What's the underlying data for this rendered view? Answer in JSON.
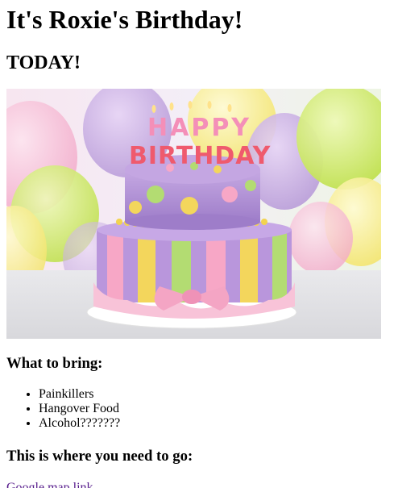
{
  "heading": "It's Roxie's Birthday!",
  "subheading": "TODAY!",
  "image": {
    "subject": "birthday-cake-with-happy-birthday-candles",
    "cake_text_top": "HAPPY",
    "cake_text_bottom": "BIRTHDAY"
  },
  "bring": {
    "title": "What to bring:",
    "items": [
      "Painkillers",
      "Hangover Food",
      "Alcohol???????"
    ]
  },
  "directions": {
    "title": "This is where you need to go:",
    "link_label": "Google map link"
  },
  "colors": {
    "visited_link": "#551a8b"
  }
}
